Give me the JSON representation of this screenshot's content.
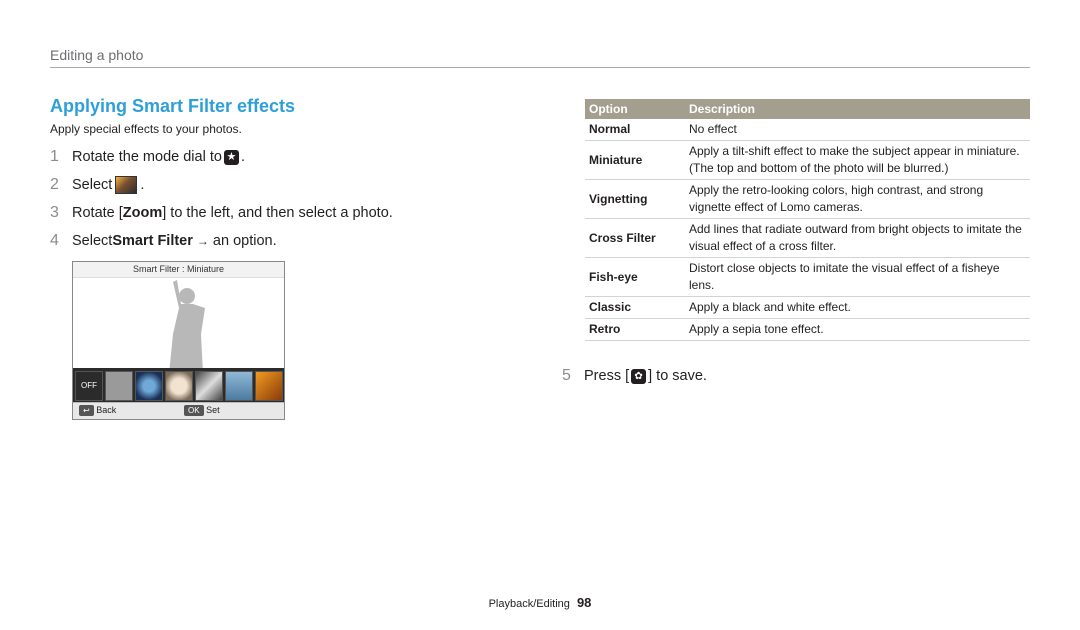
{
  "header": {
    "section": "Editing a photo"
  },
  "title": "Applying Smart Filter effects",
  "subtitle": "Apply special effects to your photos.",
  "steps": [
    {
      "num": "1",
      "pre": "Rotate the mode dial to ",
      "icon": "camera-star-icon",
      "post": "."
    },
    {
      "num": "2",
      "pre": "Select ",
      "icon": "smart-filter-icon",
      "post": "."
    },
    {
      "num": "3",
      "pre": "Rotate [",
      "bold": "Zoom",
      "post": "] to the left, and then select a photo."
    },
    {
      "num": "4",
      "pre": "Select ",
      "bold": "Smart Filter",
      "arrow": "→",
      "post": " an option."
    }
  ],
  "screen": {
    "top_label": "Smart Filter : Miniature",
    "back_label": "Back",
    "set_label": "Set",
    "ok_key": "OK",
    "off_label": "OFF"
  },
  "table": {
    "headers": [
      "Option",
      "Description"
    ],
    "rows": [
      {
        "option": "Normal",
        "description": "No effect"
      },
      {
        "option": "Miniature",
        "description": "Apply a tilt-shift effect to make the subject appear in miniature. (The top and bottom of the photo will be blurred.)"
      },
      {
        "option": "Vignetting",
        "description": "Apply the retro-looking colors, high contrast, and strong vignette effect of Lomo cameras."
      },
      {
        "option": "Cross Filter",
        "description": "Add lines that radiate outward from bright objects to imitate the visual effect of a cross filter."
      },
      {
        "option": "Fish-eye",
        "description": "Distort close objects to imitate the visual effect of a fisheye lens."
      },
      {
        "option": "Classic",
        "description": "Apply a black and white effect."
      },
      {
        "option": "Retro",
        "description": "Apply a sepia tone effect."
      }
    ]
  },
  "step5": {
    "num": "5",
    "pre": "Press [",
    "icon": "macro-flower-icon",
    "post": "] to save."
  },
  "footer": {
    "section": "Playback/Editing",
    "page": "98"
  },
  "colors": {
    "accent": "#2e9fd9",
    "table_header": "#a39e8e"
  }
}
